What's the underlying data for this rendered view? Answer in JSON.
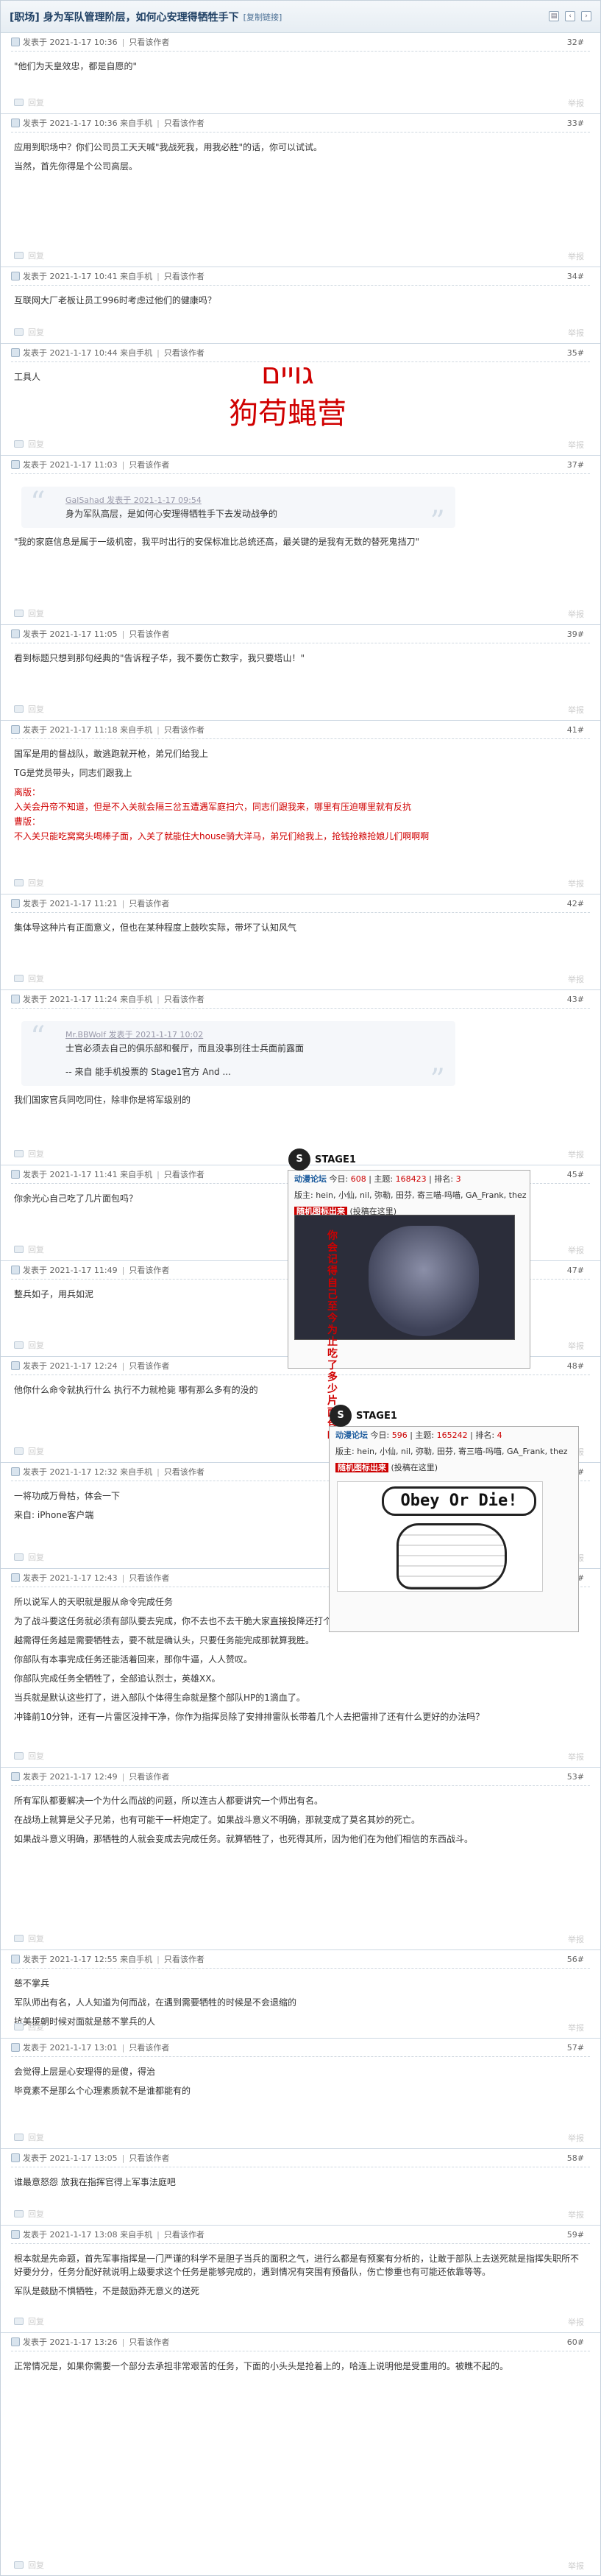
{
  "thread": {
    "title": "[职场] 身为军队管理阶层，如何心安理得牺牲手下",
    "copy_link": "[复制链接]"
  },
  "common": {
    "posted_prefix": "发表于",
    "author_only": "只看该作者",
    "actions": [
      "回复",
      "举报"
    ]
  },
  "posts": [
    {
      "floor": "32#",
      "time": "2021-1-17 10:36",
      "lines": [
        "\"他们为天皇效忠，都是自愿的\""
      ]
    },
    {
      "floor": "33#",
      "time": "2021-1-17 10:36",
      "source": "来自手机",
      "lines": [
        "应用到职场中？你们公司员工天天喊\"我战死我，用我必胜\"的话，你可以试试。",
        "当然，首先你得是个公司高层。"
      ]
    },
    {
      "floor": "34#",
      "time": "2021-1-17 10:41",
      "source": "来自手机",
      "lines": [
        "互联网大厂老板让员工996时考虑过他们的健康吗？"
      ]
    },
    {
      "floor": "35#",
      "time": "2021-1-17 10:44",
      "source": "来自手机",
      "lines": [
        "工具人"
      ]
    },
    {
      "floor": "37#",
      "time": "2021-1-17 11:03",
      "quote_src": "GalSahad 发表于 2021-1-17 09:54",
      "quote": "身为军队高层，是如何心安理得牺牲手下去发动战争的",
      "lines": [
        "\"我的家庭信息是属于一级机密，我平时出行的安保标准比总统还高，最关键的是我有无数的替死鬼挡刀\""
      ]
    },
    {
      "floor": "39#",
      "time": "2021-1-17 11:05",
      "lines": [
        "看到标题只想到那句经典的\"告诉程子华，我不要伤亡数字，我只要塔山！\""
      ]
    },
    {
      "floor": "41#",
      "time": "2021-1-17 11:18",
      "source": "来自手机",
      "lines": [
        "国军是用的督战队，敢逃跑就开枪，弟兄们给我上",
        "TG是党员带头，同志们跟我上"
      ],
      "red_lines": [
        "离版：",
        "入关会丹帝不知道，但是不入关就会隔三岔五遭遇军庭扫穴，同志们跟我来，哪里有压迫哪里就有反抗",
        "曹版：",
        "不入关只能吃窝窝头喝棒子面，入关了就能住大house骑大洋马，弟兄们给我上，抢钱抢粮抢娘儿们啊啊啊"
      ]
    },
    {
      "floor": "42#",
      "time": "2021-1-17 11:21",
      "lines": [
        "集体导这种片有正面意义，但也在某种程度上鼓吹实际，带坏了认知风气"
      ]
    },
    {
      "floor": "43#",
      "time": "2021-1-17 11:24",
      "source": "来自手机",
      "quote_src": "Mr.BBWolf 发表于 2021-1-17 10:02",
      "quote": "士官必须去自己的俱乐部和餐厅，而且没事别往士兵面前露面",
      "quote2": "-- 来自 能手机投票的 Stage1官方 And ...",
      "lines": [
        "我们国家官兵同吃同住，除非你是将军级别的"
      ]
    },
    {
      "floor": "45#",
      "time": "2021-1-17 11:41",
      "source": "来自手机",
      "lines": [
        "你余光心自己吃了几片面包吗？"
      ]
    },
    {
      "floor": "47#",
      "time": "2021-1-17 11:49",
      "lines": [
        "整兵如子，用兵如泥"
      ]
    },
    {
      "floor": "48#",
      "time": "2021-1-17 12:24",
      "lines": [
        "他你什么命令就执行什么  执行不力就枪毙  哪有那么多有的没的"
      ]
    },
    {
      "floor": "49#",
      "time": "2021-1-17 12:32",
      "source": "来自手机",
      "lines": [
        "一将功成万骨枯，体会一下"
      ],
      "device": "来自: iPhone客户端"
    },
    {
      "floor": "51#",
      "time": "2021-1-17 12:43",
      "lines": [
        "所以说军人的天职就是服从命令完成任务",
        "为了战斗要这任务就必须有部队要去完成，你不去也不去干脆大家直接投降还打个屁。",
        "越需得任务越是需要牺牲去，要不就是确认头，只要任务能完成那就算我胜。",
        "你部队有本事完成任务还能活着回来，那你牛逼，人人赞叹。",
        "你部队完成任务全牺牲了，全部追认烈士，英雄XX。",
        "当兵就是默认这些打了，进入部队个体得生命就是整个部队HP的1滴血了。",
        "冲锋前10分钟，还有一片雷区没排干净，你作为指挥员除了安排排雷队长带着几个人去把雷排了还有什么更好的办法吗？"
      ]
    },
    {
      "floor": "53#",
      "time": "2021-1-17 12:49",
      "lines": [
        "所有军队都要解决一个为什么而战的问题，所以连古人都要讲究一个师出有名。",
        "在战场上就算是父子兄弟，也有可能干一杆炮定了。如果战斗意义不明确，那就变成了莫名其妙的死亡。",
        "如果战斗意义明确，那牺牲的人就会变成去完成任务。就算牺牲了，也死得其所，因为他们在为他们相信的东西战斗。"
      ]
    },
    {
      "floor": "56#",
      "time": "2021-1-17 12:55",
      "source": "来自手机",
      "lines": [
        "慈不掌兵",
        "军队师出有名，人人知道为何而战，在遇到需要牺牲的时候是不会退缩的",
        "抗美援朝时候对面就是慈不掌兵的人"
      ]
    },
    {
      "floor": "57#",
      "time": "2021-1-17 13:01",
      "lines": [
        "会觉得上层是心安理得的是傻，得治",
        "毕竟素不是那么个心理素质就不是谁都能有的"
      ]
    },
    {
      "floor": "58#",
      "time": "2021-1-17 13:05",
      "lines": [
        "谁最意怒怨  放我在指挥官得上军事法庭吧"
      ]
    },
    {
      "floor": "59#",
      "time": "2021-1-17 13:08",
      "source": "来自手机",
      "lines": [
        "根本就是先命题，首先军事指挥是一门严谨的科学不是胆子当兵的面积之气，进行么都是有预案有分析的，让敢于部队上去送死就是指挥失职所不好要分分，任务分配好就说明上级要求这个任务是能够完成的，遇到情况有突围有预备队，伤亡惨重也有可能还依靠等等。",
        "军队是鼓励不惧牺牲，不是鼓励莽无意义的送死"
      ]
    },
    {
      "floor": "60#",
      "time": "2021-1-17 13:26",
      "lines": [
        "正常情况是，如果你需要一个部分去承担非常艰苦的任务，下面的小头头是抢着上的，哈连上说明他是受重用的。被瞧不起的。"
      ]
    }
  ],
  "ad_watermark": {
    "line1": "גויים",
    "line2": "狗苟蝇营"
  },
  "stage_cards": [
    {
      "brand": "STAGE1",
      "forum": "动漫论坛",
      "today_label": "今日:",
      "today": "608",
      "topics_label": "主题:",
      "topics": "168423",
      "rank_label": "排名:",
      "rank": "3",
      "mods": "版主: hein, 小仙, nil, 弥勒, 田芬, 寄三喵-吗喵, GA_Frank, thez",
      "random_label": "随机图标出来",
      "random_note": "(投稿在这里)",
      "meme_text": "你会记得自己至今为止吃了多少片面包吗？"
    },
    {
      "brand": "STAGE1",
      "forum": "动漫论坛",
      "today_label": "今日:",
      "today": "596",
      "topics_label": "主题:",
      "topics": "165242",
      "rank_label": "排名:",
      "rank": "4",
      "mods": "版主: hein, 小仙, nil, 弥勒, 田芬, 寄三喵-吗喵, GA_Frank, thez",
      "random_label": "随机图标出来",
      "random_note": "(投稿在这里)",
      "meme_text": "Obey Or Die!"
    }
  ]
}
